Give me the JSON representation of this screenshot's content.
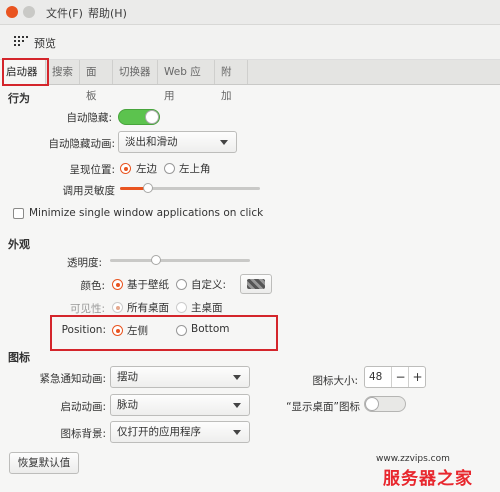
{
  "menubar": {
    "file": "文件(F)",
    "help": "帮助(H)"
  },
  "toolbar": {
    "preview_label": "预览"
  },
  "tabs": [
    "启动器",
    "搜索",
    "面板",
    "切换器",
    "Web 应用",
    "附加"
  ],
  "behavior": {
    "section_title": "行为",
    "autohide_label": "自动隐藏:",
    "autohide_anim_label": "自动隐藏动画:",
    "autohide_anim_value": "淡出和滑动",
    "reveal_label": "呈现位置:",
    "reveal_left": "左边",
    "reveal_topleft": "左上角",
    "sensitivity_label": "调用灵敏度",
    "sensitivity_value": 0.2,
    "minimize_label": "Minimize single window applications on click"
  },
  "appearance": {
    "section_title": "外观",
    "transparency_label": "透明度:",
    "transparency_value": 0.33,
    "color_label": "颜色:",
    "color_wallpaper": "基于壁纸",
    "color_custom": "自定义:",
    "visibility_label": "可见性:",
    "visibility_all": "所有桌面",
    "visibility_main": "主桌面",
    "position_label": "Position:",
    "position_left": "左侧",
    "position_bottom": "Bottom"
  },
  "icons": {
    "section_title": "图标",
    "urgent_anim_label": "紧急通知动画:",
    "urgent_anim_value": "摆动",
    "launch_anim_label": "启动动画:",
    "launch_anim_value": "脉动",
    "backlight_label": "图标背景:",
    "backlight_value": "仅打开的应用程序",
    "icon_size_label": "图标大小:",
    "icon_size_value": "48",
    "minus": "−",
    "plus": "+",
    "show_desktop_label": "“显示桌面”图标"
  },
  "reset_button": "恢复默认值",
  "watermark": {
    "url": "www.zzvips.com",
    "brand": "服务器之家"
  }
}
